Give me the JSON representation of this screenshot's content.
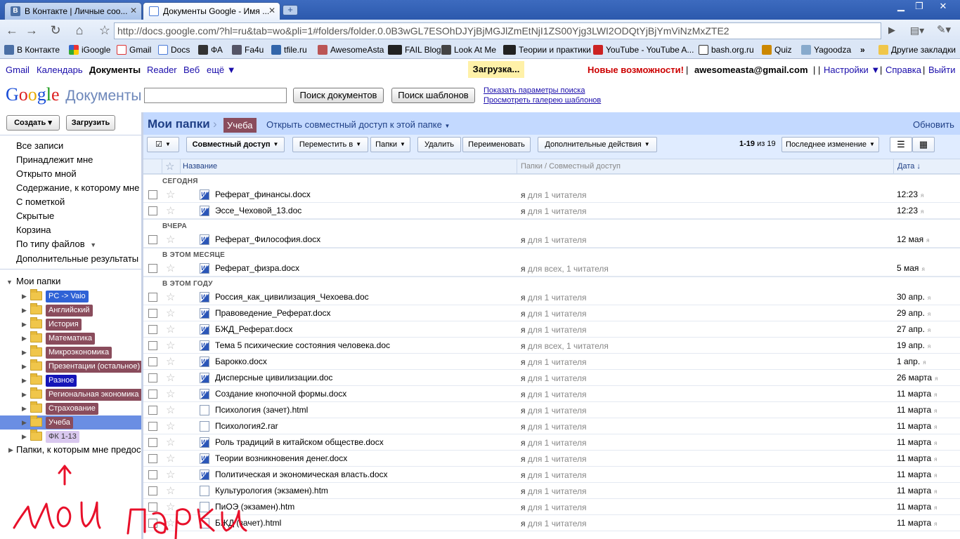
{
  "browser": {
    "tabs": [
      {
        "label": "В Контакте | Личные соо...",
        "active": false
      },
      {
        "label": "Документы Google - Имя ...",
        "active": true
      }
    ],
    "url": "http://docs.google.com/?hl=ru&tab=wo&pli=1#folders/folder.0.0B3wGL7ESOhDJYjBjMGJlZmEtNjI1ZS00Yjg3LWI2ODQtYjBjYmViNzMxZTE2",
    "bookmarks": [
      "В Контакте",
      "iGoogle",
      "Gmail",
      "Docs",
      "ФА",
      "Fa4u",
      "tfile.ru",
      "AwesomeAsta",
      "FAIL Blog",
      "Look At Me",
      "Теории и практики",
      "YouTube - YouTube A...",
      "bash.org.ru",
      "Quiz",
      "Yagoodza"
    ],
    "bookmarks_more": "»",
    "other_bookmarks": "Другие закладки"
  },
  "gbar": {
    "links": [
      "Gmail",
      "Календарь",
      "Документы",
      "Reader",
      "Веб",
      "ещё ▼"
    ],
    "loading": "Загрузка...",
    "whats_new": "Новые возможности!",
    "email": "awesomeasta@gmail.com",
    "settings": "Настройки ▼",
    "help": "Справка",
    "logout": "Выйти"
  },
  "search": {
    "logo_google": "Google",
    "logo_product": "Документы",
    "search_docs": "Поиск документов",
    "search_templates": "Поиск шаблонов",
    "show_options": "Показать параметры поиска",
    "gallery": "Просмотреть галерею шаблонов"
  },
  "left": {
    "create": "Создать ▾",
    "upload": "Загрузить",
    "filters": [
      "Все записи",
      "Принадлежит мне",
      "Открыто мной",
      "Содержание, к которому мне",
      "С пометкой",
      "Скрытые",
      "Корзина",
      "По типу файлов",
      "Дополнительные результаты"
    ],
    "my_folders": "Мои папки",
    "folders": [
      {
        "name": "PC -> Vaio",
        "color": "#2f62d6"
      },
      {
        "name": "Английский",
        "color": "#8a4c5c"
      },
      {
        "name": "История",
        "color": "#8a4c5c"
      },
      {
        "name": "Математика",
        "color": "#8a4c5c"
      },
      {
        "name": "Микроэкономика",
        "color": "#8a4c5c"
      },
      {
        "name": "Презентации (остальное)",
        "color": "#8a4c5c"
      },
      {
        "name": "Разное",
        "color": "#1515b8"
      },
      {
        "name": "Региональная экономика",
        "color": "#8a4c5c"
      },
      {
        "name": "Страхование",
        "color": "#8a4c5c"
      },
      {
        "name": "Учеба",
        "color": "#8a4c5c"
      },
      {
        "name": "ФК 1-13",
        "color": "#d9c8ef"
      }
    ],
    "selected_folder": "Учеба",
    "shared_folders": "Папки, к которым мне предос"
  },
  "main": {
    "breadcrumb_root": "Мои папки",
    "breadcrumb_sep": "›",
    "current_folder": "Учеба",
    "share_folder": "Открыть совместный доступ к этой папке",
    "refresh": "Обновить",
    "toolbar": {
      "select": "☑",
      "sharing": "Совместный доступ",
      "move_to": "Переместить в",
      "folders": "Папки",
      "delete": "Удалить",
      "rename": "Переименовать",
      "more_actions": "Дополнительные действия",
      "count_range": "1-19",
      "count_of": "из 19",
      "sort": "Последнее изменение"
    },
    "columns": {
      "name": "Название",
      "folders": "Папки / Совместный доступ",
      "date": "Дата ↓"
    },
    "groups": [
      {
        "title": "СЕГОДНЯ",
        "rows": [
          {
            "name": "Реферат_финансы.docx",
            "type": "word",
            "owner": "я",
            "share": "для 1 читателя",
            "date": "12:23"
          },
          {
            "name": "Эссе_Чеховой_13.doc",
            "type": "word",
            "owner": "я",
            "share": "для 1 читателя",
            "date": "12:23"
          }
        ]
      },
      {
        "title": "ВЧЕРА",
        "rows": [
          {
            "name": "Реферат_Философия.docx",
            "type": "word",
            "owner": "я",
            "share": "для 1 читателя",
            "date": "12 мая"
          }
        ]
      },
      {
        "title": "В ЭТОМ МЕСЯЦЕ",
        "rows": [
          {
            "name": "Реферат_физра.docx",
            "type": "word",
            "owner": "я",
            "share": "для всех, 1 читателя",
            "date": "5 мая"
          }
        ]
      },
      {
        "title": "В ЭТОМ ГОДУ",
        "rows": [
          {
            "name": "Россия_как_цивилизация_Чехоева.doc",
            "type": "word",
            "owner": "я",
            "share": "для 1 читателя",
            "date": "30 апр."
          },
          {
            "name": "Правоведение_Реферат.docx",
            "type": "word",
            "owner": "я",
            "share": "для 1 читателя",
            "date": "29 апр."
          },
          {
            "name": "БЖД_Реферат.docx",
            "type": "word",
            "owner": "я",
            "share": "для 1 читателя",
            "date": "27 апр."
          },
          {
            "name": "Тема 5 психические состояния человека.doc",
            "type": "word",
            "owner": "я",
            "share": "для всех, 1 читателя",
            "date": "19 апр."
          },
          {
            "name": "Барокко.docx",
            "type": "word",
            "owner": "я",
            "share": "для 1 читателя",
            "date": "1 апр."
          },
          {
            "name": "Дисперсные цивилизации.doc",
            "type": "word",
            "owner": "я",
            "share": "для 1 читателя",
            "date": "26 марта"
          },
          {
            "name": "Создание кнопочной формы.docx",
            "type": "word",
            "owner": "я",
            "share": "для 1 читателя",
            "date": "11 марта"
          },
          {
            "name": "Психология (зачет).html",
            "type": "file",
            "owner": "я",
            "share": "для 1 читателя",
            "date": "11 марта"
          },
          {
            "name": "Психология2.rar",
            "type": "file",
            "owner": "я",
            "share": "для 1 читателя",
            "date": "11 марта"
          },
          {
            "name": "Роль традиций в китайском обществе.docx",
            "type": "word",
            "owner": "я",
            "share": "для 1 читателя",
            "date": "11 марта"
          },
          {
            "name": "Теории возникновения денег.docx",
            "type": "word",
            "owner": "я",
            "share": "для 1 читателя",
            "date": "11 марта"
          },
          {
            "name": "Политическая и экономическая власть.docx",
            "type": "word",
            "owner": "я",
            "share": "для 1 читателя",
            "date": "11 марта"
          },
          {
            "name": "Культурология (экзамен).htm",
            "type": "file",
            "owner": "я",
            "share": "для 1 читателя",
            "date": "11 марта"
          },
          {
            "name": "ПиОЭ (экзамен).htm",
            "type": "file",
            "owner": "я",
            "share": "для 1 читателя",
            "date": "11 марта"
          },
          {
            "name": "БЖД (зачет).html",
            "type": "file",
            "owner": "я",
            "share": "для 1 читателя",
            "date": "11 марта"
          }
        ]
      }
    ]
  },
  "annotation": {
    "text": "мои папки",
    "color": "#e8102a"
  }
}
